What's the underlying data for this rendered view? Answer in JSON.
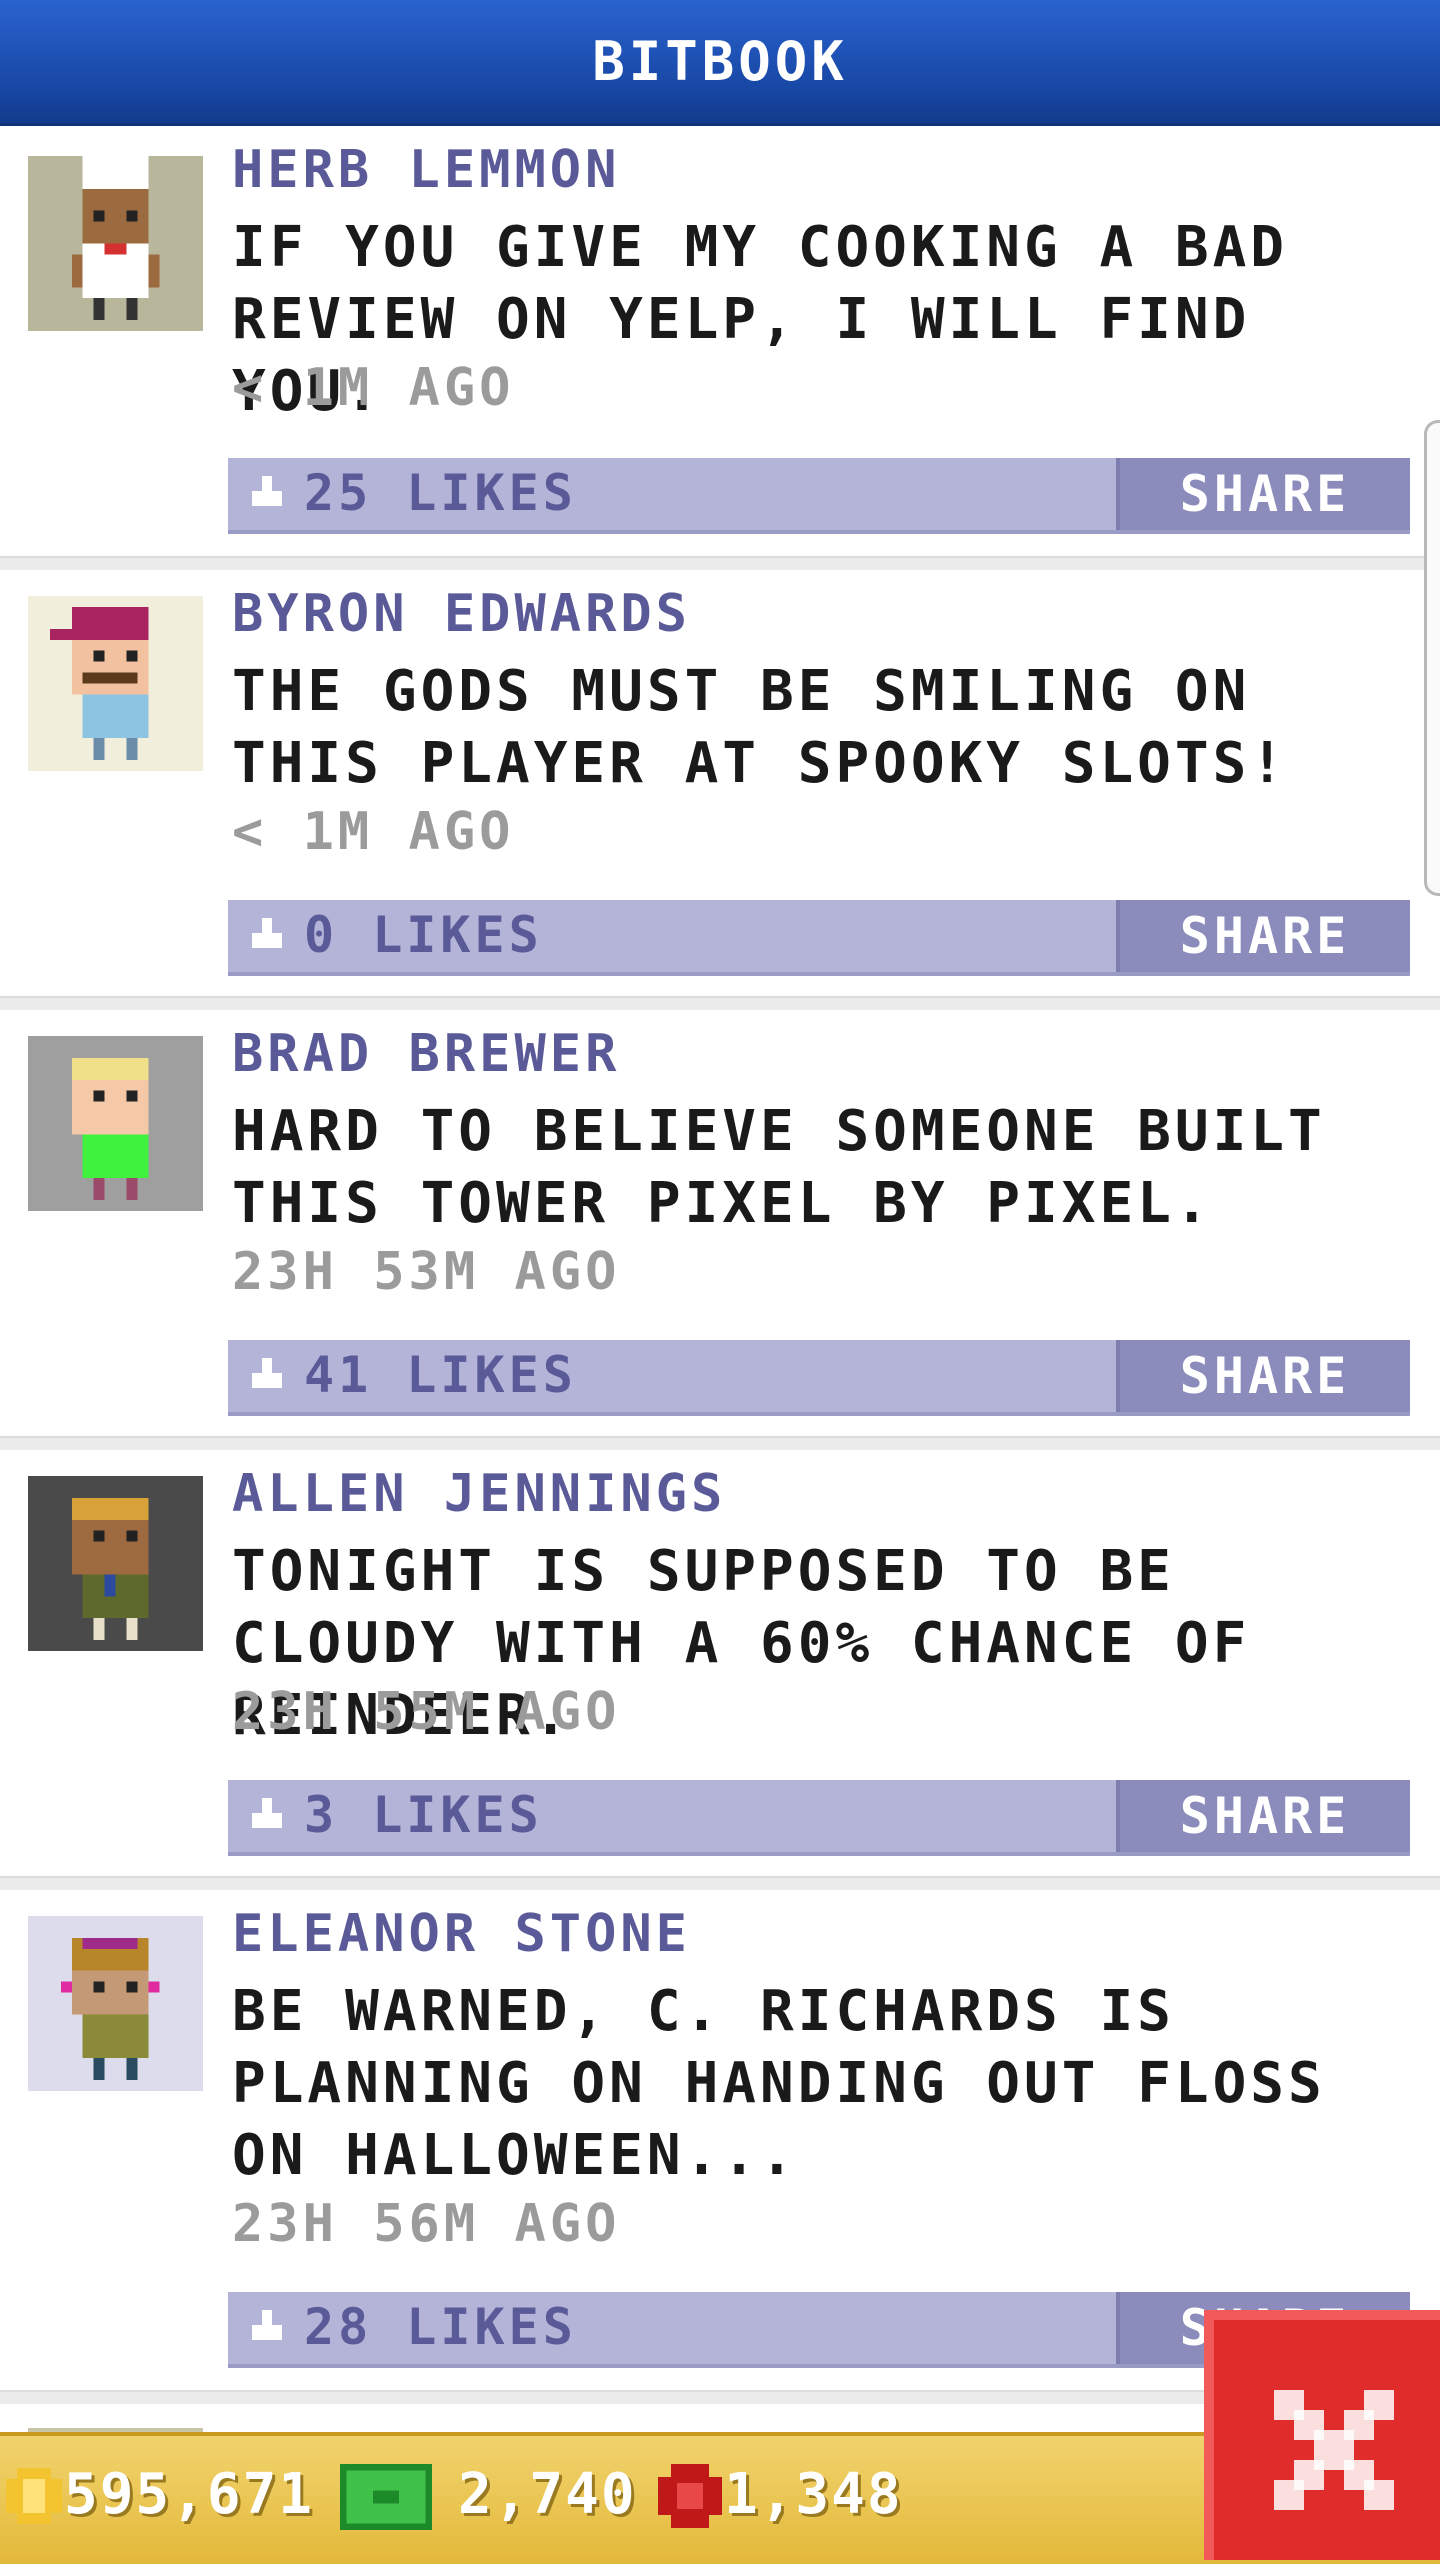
{
  "header": {
    "title": "BITBOOK"
  },
  "posts": [
    {
      "author": "HERB LEMMON",
      "message": "IF YOU GIVE MY COOKING A BAD REVIEW ON YELP, I WILL FIND YOU.",
      "time": "< 1M AGO",
      "likes": "25 LIKES",
      "share": "SHARE",
      "avatar": "chef-avatar-icon"
    },
    {
      "author": "BYRON EDWARDS",
      "message": "THE GODS MUST BE SMILING ON THIS PLAYER AT SPOOKY SLOTS!",
      "time": "< 1M AGO",
      "likes": "0 LIKES",
      "share": "SHARE",
      "avatar": "cap-avatar-icon"
    },
    {
      "author": "BRAD BREWER",
      "message": "HARD TO BELIEVE SOMEONE BUILT THIS TOWER PIXEL BY PIXEL.",
      "time": "23H 53M AGO",
      "likes": "41 LIKES",
      "share": "SHARE",
      "avatar": "blond-avatar-icon"
    },
    {
      "author": "ALLEN JENNINGS",
      "message": "TONIGHT IS SUPPOSED TO BE CLOUDY WITH A 60% CHANCE OF REINDEER.",
      "time": "23H 55M AGO",
      "likes": "3 LIKES",
      "share": "SHARE",
      "avatar": "soldier-avatar-icon"
    },
    {
      "author": "ELEANOR STONE",
      "message": "BE WARNED, C. RICHARDS IS PLANNING ON HANDING OUT FLOSS ON HALLOWEEN...",
      "time": "23H 56M AGO",
      "likes": "28 LIKES",
      "share": "SHARE",
      "avatar": "woman-avatar-icon"
    }
  ],
  "resources": {
    "coins": "595,671",
    "bux": "2,740",
    "gems": "1,348"
  },
  "colors": {
    "header": "#1848a6",
    "author": "#5b5a98",
    "likebar": "#b4b4d8",
    "share": "#8c8cbc",
    "close": "#e12c2c",
    "bottom": "#e3b93a"
  }
}
